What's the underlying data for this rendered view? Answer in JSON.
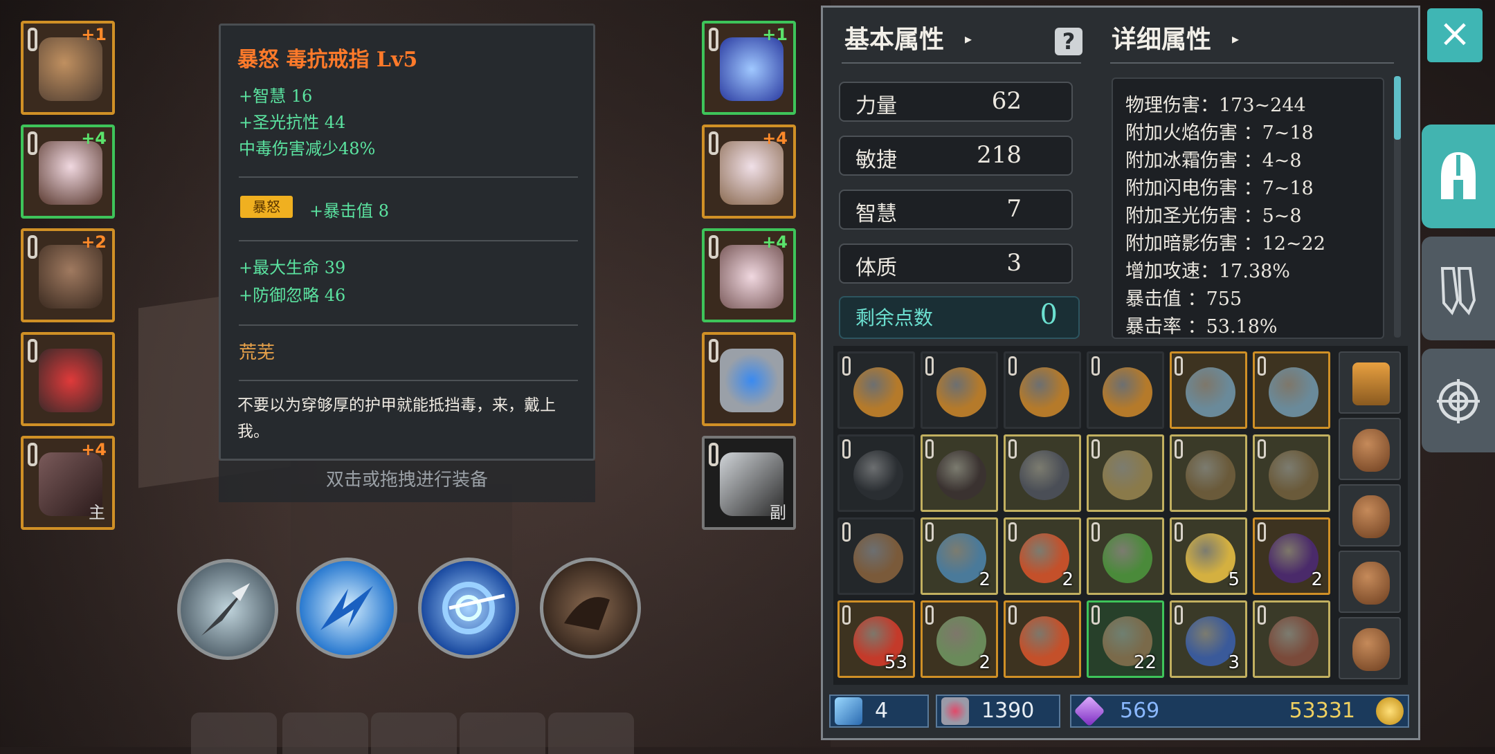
{
  "equipment_left": [
    {
      "plus": "+1",
      "border": "gold",
      "sub": ""
    },
    {
      "plus": "+4",
      "border": "green",
      "sub": ""
    },
    {
      "plus": "+2",
      "border": "gold",
      "sub": ""
    },
    {
      "plus": "",
      "border": "gold",
      "sub": ""
    },
    {
      "plus": "+4",
      "border": "gold",
      "sub": "主"
    }
  ],
  "equipment_right": [
    {
      "plus": "+1",
      "border": "green",
      "sub": ""
    },
    {
      "plus": "+4",
      "border": "gold",
      "sub": ""
    },
    {
      "plus": "+4",
      "border": "green",
      "sub": ""
    },
    {
      "plus": "",
      "border": "gold",
      "sub": ""
    },
    {
      "plus": "",
      "border": "gray",
      "sub": "副"
    }
  ],
  "tooltip": {
    "title": "暴怒  毒抗戒指  Lv5",
    "stats": [
      "+智慧  16",
      "+圣光抗性  44",
      "中毒伤害减少48%"
    ],
    "badge": "暴怒",
    "badge_stat": "+暴击值  8",
    "extra_stats": [
      "+最大生命  39",
      "+防御忽略  46"
    ],
    "set_name": "荒芜",
    "description": "不要以为穿够厚的护甲就能抵挡毒，来，戴上我。",
    "hint": "双击或拖拽进行装备"
  },
  "panel": {
    "basic_title": "基本属性",
    "detail_title": "详细属性",
    "help": "?",
    "attributes": [
      {
        "name": "力量",
        "value": "62"
      },
      {
        "name": "敏捷",
        "value": "218"
      },
      {
        "name": "智慧",
        "value": "7"
      },
      {
        "name": "体质",
        "value": "3"
      }
    ],
    "remaining": {
      "name": "剩余点数",
      "value": "0"
    },
    "details": [
      "物理伤害：173~244",
      "附加火焰伤害 ：7~18",
      "附加冰霜伤害 ：4~8",
      "附加闪电伤害 ：7~18",
      "附加圣光伤害 ：5~8",
      "附加暗影伤害 ：12~22",
      "增加攻速：17.38%",
      "暴击值 ：755",
      "暴击率 ：53.18%"
    ]
  },
  "bag": {
    "rows": [
      [
        {
          "b": "none",
          "c": "",
          "color": "#b57a2a"
        },
        {
          "b": "none",
          "c": "",
          "color": "#b57a2a"
        },
        {
          "b": "none",
          "c": "",
          "color": "#b57a2a"
        },
        {
          "b": "none",
          "c": "",
          "color": "#b57a2a"
        },
        {
          "b": "gold",
          "c": "",
          "color": "#6a8a9a"
        },
        {
          "b": "gold",
          "c": "",
          "color": "#6a8a9a"
        }
      ],
      [
        {
          "b": "none",
          "c": "",
          "color": "#2a2e32"
        },
        {
          "b": "olive",
          "c": "",
          "color": "#3a3230"
        },
        {
          "b": "olive",
          "c": "",
          "color": "#4a4e56"
        },
        {
          "b": "olive",
          "c": "",
          "color": "#8a7a4a"
        },
        {
          "b": "olive",
          "c": "",
          "color": "#6a5a3a"
        },
        {
          "b": "olive",
          "c": "",
          "color": "#6a5a3a"
        }
      ],
      [
        {
          "b": "none",
          "c": "",
          "color": "#7a5a3a"
        },
        {
          "b": "olive",
          "c": "2",
          "color": "#4a7a9a"
        },
        {
          "b": "olive",
          "c": "2",
          "color": "#c4502a"
        },
        {
          "b": "olive",
          "c": "",
          "color": "#4a8a3a"
        },
        {
          "b": "olive",
          "c": "5",
          "color": "#d4b040"
        },
        {
          "b": "gold",
          "c": "2",
          "color": "#4a2a6a"
        }
      ],
      [
        {
          "b": "gold",
          "c": "53",
          "color": "#c43a2a"
        },
        {
          "b": "gold",
          "c": "2",
          "color": "#6a8a5a"
        },
        {
          "b": "gold",
          "c": "",
          "color": "#c4502a"
        },
        {
          "b": "green",
          "c": "22",
          "color": "#7a6a4a"
        },
        {
          "b": "olive",
          "c": "3",
          "color": "#3a5a9a"
        },
        {
          "b": "olive",
          "c": "",
          "color": "#7a4a3a"
        }
      ]
    ],
    "side_items": 5
  },
  "currency": {
    "wand": "4",
    "hearts": "1390",
    "gems": "569",
    "gold": "53331"
  },
  "colors": {
    "accent_teal": "#3fb6b4",
    "gold_border": "#d09026",
    "green_border": "#3ec45a",
    "title_orange": "#ff7a2a",
    "stat_green": "#5be3a0"
  },
  "icons": {
    "close": "×"
  }
}
